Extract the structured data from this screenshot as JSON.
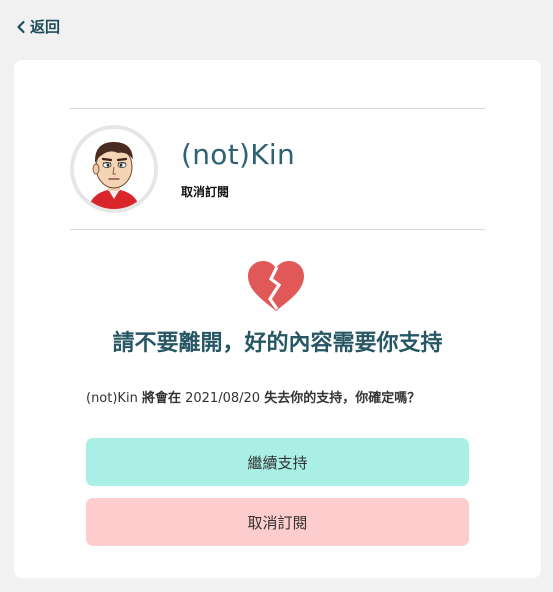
{
  "nav": {
    "back_label": "返回"
  },
  "creator": {
    "name": "(not)Kin",
    "subtitle": "取消訂閱"
  },
  "message": {
    "headline": "請不要離開，好的內容需要你支持",
    "confirm_name": "(not)Kin",
    "confirm_will": "將會在",
    "confirm_date": "2021/08/20",
    "confirm_tail": "失去你的支持，你確定嗎？"
  },
  "actions": {
    "keep_label": "繼續支持",
    "cancel_label": "取消訂閱"
  },
  "colors": {
    "keep_button": "#a9efe6",
    "cancel_button": "#fdcccc",
    "heart": "#e05858",
    "accent_text": "#275764"
  }
}
